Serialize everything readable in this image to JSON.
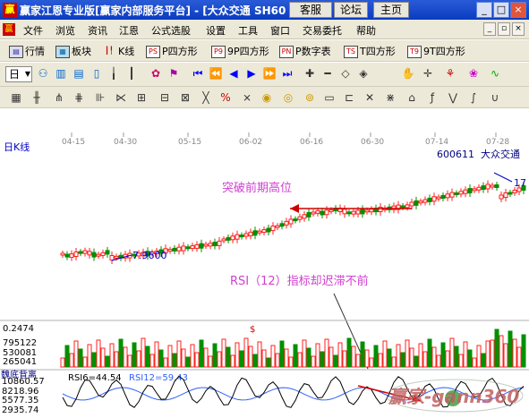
{
  "window": {
    "logo": "赢",
    "title": "赢家江恩专业版[赢家内部服务平台] - [大众交通  SH60",
    "buttons": [
      "客服",
      "论坛",
      "主页"
    ],
    "controls": [
      "_",
      "□",
      "×"
    ]
  },
  "menu": {
    "logo": "赢",
    "items": [
      "文件",
      "浏览",
      "资讯",
      "江恩",
      "公式选股",
      "设置",
      "工具",
      "窗口",
      "交易委托",
      "帮助"
    ],
    "window_controls": [
      "_",
      "▫",
      "×"
    ]
  },
  "toolbar1": {
    "items": [
      {
        "label": "行情",
        "icon": "table-icon"
      },
      {
        "label": "板块",
        "icon": "grid-icon"
      },
      {
        "label": "K线",
        "icon": "candlestick-icon"
      },
      {
        "label": "P四方形",
        "icon_text": "PS"
      },
      {
        "label": "9P四方形",
        "icon_text": "P9"
      },
      {
        "label": "P数字表",
        "icon_text": "PN"
      },
      {
        "label": "T四方形",
        "icon_text": "TS"
      },
      {
        "label": "9T四方形",
        "icon_text": "T9"
      }
    ]
  },
  "toolbar2": {
    "day_selector": "日",
    "icons": [
      "candle-icon",
      "chart-icon",
      "list-icon",
      "doc-icon",
      "bar-icon",
      "candle-up-icon",
      "pattern-icon",
      "flag-icon",
      "first-icon",
      "prev-page-icon",
      "prev-icon",
      "next-icon",
      "next-page-icon",
      "last-icon",
      "zoom-in-icon",
      "zoom-out-icon",
      "fit-icon",
      "expand-icon",
      "hand-icon",
      "cross-icon",
      "select-icon",
      "star-icon",
      "wave-icon"
    ]
  },
  "toolbar3": {
    "icons": [
      "calendar-icon",
      "lines-icon",
      "fan-icon",
      "cycle-icon",
      "ruler-icon",
      "fork-icon",
      "square-icon",
      "percent-icon",
      "x-icon",
      "y-icon",
      "z-icon",
      "coin-icon",
      "coin2-icon",
      "box-icon",
      "rect-icon",
      "bars-icon",
      "boxes-icon",
      "x2-icon",
      "flow-icon",
      "hat-icon",
      "f-icon",
      "v-icon",
      "s-icon",
      "u-icon"
    ]
  },
  "chart": {
    "period_label": "日K线",
    "stock_code": "600611",
    "stock_name": "大众交通",
    "date_ticks": [
      "04-15",
      "04-30",
      "05-15",
      "06-02",
      "06-16",
      "06-30",
      "07-14",
      "07-28"
    ],
    "low_label": "7.9600",
    "high_label": "17",
    "annotation_top": "突破前期高位",
    "annotation_rsi": "RSI（12）指标却迟滞不前",
    "volume_axis": [
      "0.2474",
      "795122",
      "530081",
      "265041"
    ],
    "indicator_name": "魏底背离",
    "rsi_axis": [
      "10860.57",
      "8218.96",
      "5577.35",
      "2935.74"
    ],
    "rsi6_label": "RSI6=44.54",
    "rsi12_label": "RSI12=59.43",
    "dollar_marker": "$",
    "watermark": "赢家-gann360",
    "colors": {
      "up": "#ff2020",
      "down": "#009000",
      "annotation": "#d040d0",
      "rsi6": "#000000",
      "rsi12": "#3060ff"
    }
  }
}
